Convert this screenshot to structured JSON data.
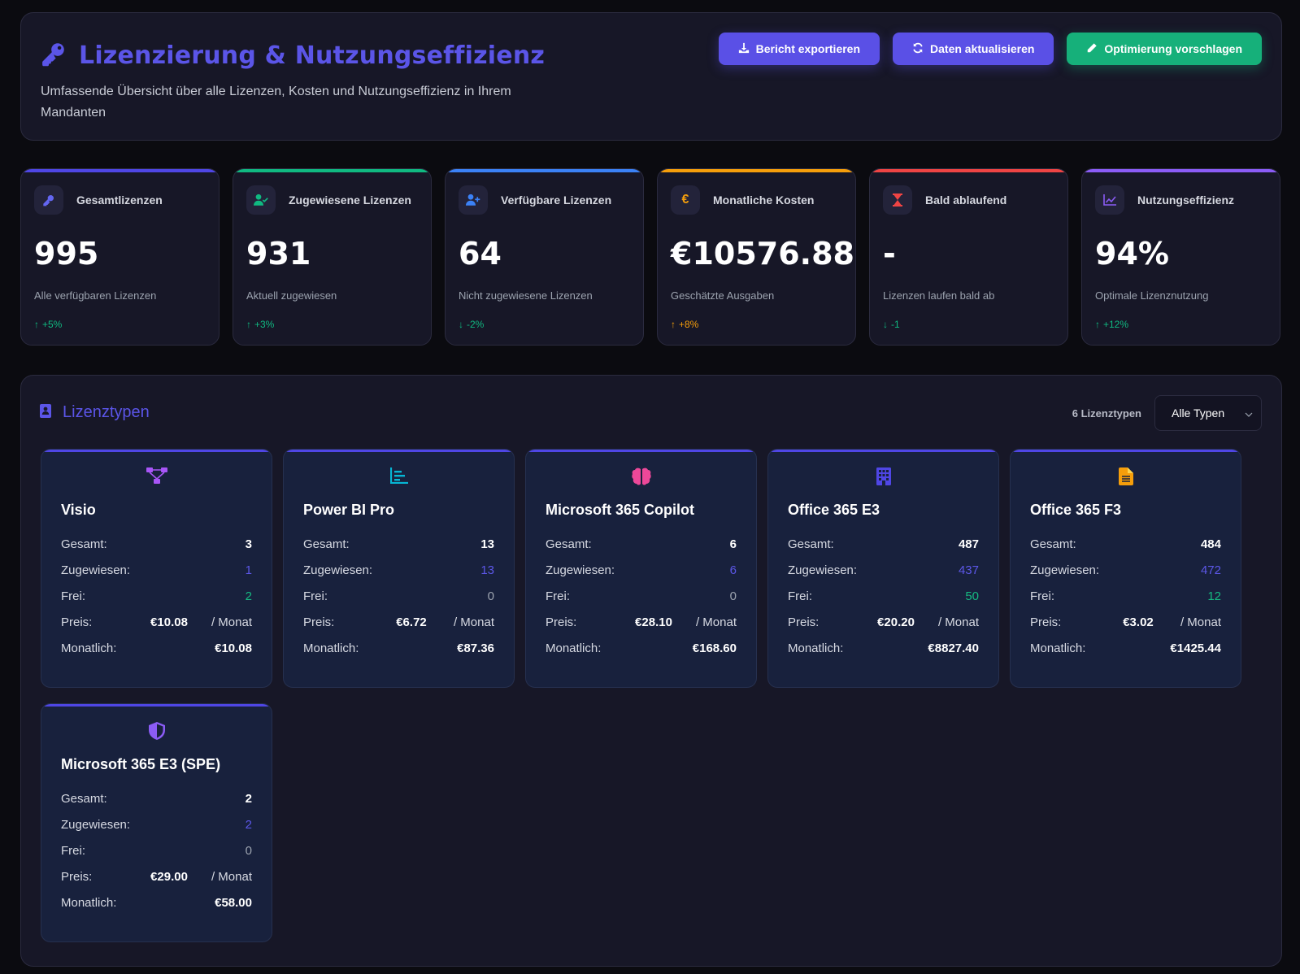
{
  "header": {
    "title": "Lizenzierung & Nutzungseffizienz",
    "subtitle": "Umfassende Übersicht über alle Lizenzen, Kosten und Nutzungseffizienz in Ihrem Mandanten",
    "icon": "key-icon",
    "buttons": {
      "export": "Bericht exportieren",
      "refresh": "Daten aktualisieren",
      "optimize": "Optimierung vorschlagen"
    }
  },
  "stats": [
    {
      "label": "Gesamtlizenzen",
      "value": "995",
      "desc": "Alle verfügbaren Lizenzen",
      "trend": "+5%",
      "trend_dir": "up",
      "color": "#4f46e5",
      "icon": "key-icon"
    },
    {
      "label": "Zugewiesene Lizenzen",
      "value": "931",
      "desc": "Aktuell zugewiesen",
      "trend": "+3%",
      "trend_dir": "up",
      "color": "#10b981",
      "icon": "user-check-icon"
    },
    {
      "label": "Verfügbare Lizenzen",
      "value": "64",
      "desc": "Nicht zugewiesene Lizenzen",
      "trend": "-2%",
      "trend_dir": "down",
      "color": "#3b82f6",
      "icon": "user-plus-icon"
    },
    {
      "label": "Monatliche Kosten",
      "value": "€10576.88",
      "desc": "Geschätzte Ausgaben",
      "trend": "+8%",
      "trend_dir": "up",
      "color": "#f59e0b",
      "icon": "euro-icon"
    },
    {
      "label": "Bald ablaufend",
      "value": "-",
      "desc": "Lizenzen laufen bald ab",
      "trend": "-1",
      "trend_dir": "down",
      "color": "#ef4444",
      "icon": "hourglass-icon"
    },
    {
      "label": "Nutzungseffizienz",
      "value": "94%",
      "desc": "Optimale Lizenznutzung",
      "trend": "+12%",
      "trend_dir": "up",
      "color": "#8b5cf6",
      "icon": "chart-line-icon"
    }
  ],
  "section": {
    "title": "Lizenztypen",
    "count": "6 Lizenztypen",
    "filter_value": "Alle Typen"
  },
  "labels": {
    "total": "Gesamt:",
    "assigned": "Zugewiesen:",
    "free": "Frei:",
    "price": "Preis:",
    "per_month": "/ Monat",
    "monthly": "Monatlich:"
  },
  "licenses": [
    {
      "name": "Visio",
      "icon": "diagram-icon",
      "icon_color": "#a855f7",
      "total": "3",
      "assigned": "1",
      "free": "2",
      "price": "€10.08",
      "monthly": "€10.08"
    },
    {
      "name": "Power BI Pro",
      "icon": "bar-chart-icon",
      "icon_color": "#06b6d4",
      "total": "13",
      "assigned": "13",
      "free": "0",
      "price": "€6.72",
      "monthly": "€87.36"
    },
    {
      "name": "Microsoft 365 Copilot",
      "icon": "brain-icon",
      "icon_color": "#ec4899",
      "total": "6",
      "assigned": "6",
      "free": "0",
      "price": "€28.10",
      "monthly": "€168.60"
    },
    {
      "name": "Office 365 E3",
      "icon": "building-icon",
      "icon_color": "#4f46e5",
      "total": "487",
      "assigned": "437",
      "free": "50",
      "price": "€20.20",
      "monthly": "€8827.40"
    },
    {
      "name": "Office 365 F3",
      "icon": "document-icon",
      "icon_color": "#f59e0b",
      "total": "484",
      "assigned": "472",
      "free": "12",
      "price": "€3.02",
      "monthly": "€1425.44"
    },
    {
      "name": "Microsoft 365 E3 (SPE)",
      "icon": "shield-icon",
      "icon_color": "#8b5cf6",
      "total": "2",
      "assigned": "2",
      "free": "0",
      "price": "€29.00",
      "monthly": "€58.00"
    }
  ]
}
